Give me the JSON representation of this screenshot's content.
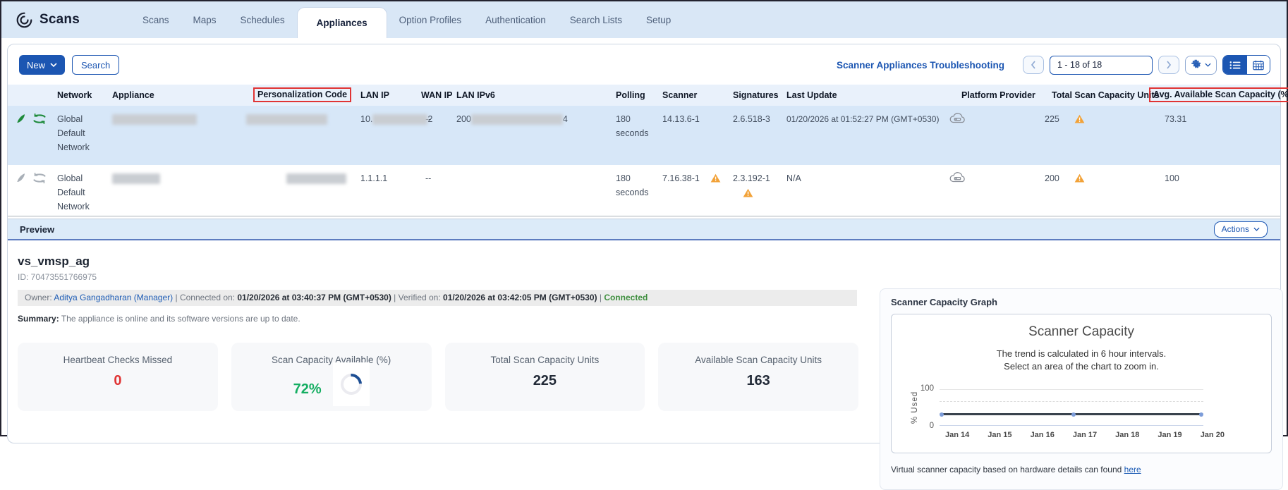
{
  "nav": {
    "app_title": "Scans",
    "tabs": [
      {
        "label": "Scans"
      },
      {
        "label": "Maps"
      },
      {
        "label": "Schedules"
      },
      {
        "label": "Appliances"
      },
      {
        "label": "Option Profiles"
      },
      {
        "label": "Authentication"
      },
      {
        "label": "Search Lists"
      },
      {
        "label": "Setup"
      }
    ]
  },
  "toolbar": {
    "new_label": "New",
    "search_label": "Search",
    "troubleshooting_link": "Scanner Appliances Troubleshooting",
    "pagination_text": "1 - 18 of 18"
  },
  "icons": {
    "sort_ascending": "↑"
  },
  "table": {
    "columns": [
      "Network",
      "Appliance",
      "Personalization Code",
      "LAN IP",
      "WAN IP",
      "LAN IPv6",
      "Polling",
      "Scanner",
      "Signatures",
      "Last Update",
      "Platform Provider",
      "Total Scan Capacity Units",
      "Avg. Available Scan Capacity (%)"
    ],
    "rows": [
      {
        "network": "Global Default Network",
        "lan_ip_prefix": "10.",
        "lan_ip_suffix": "2",
        "wan_ip": "--",
        "lan_ipv6_prefix": "200",
        "lan_ipv6_suffix": "4",
        "polling": "180 seconds",
        "scanner": "14.13.6-1",
        "signatures": "2.6.518-3",
        "last_update": "01/20/2026 at 01:52:27 PM (GMT+0530)",
        "total_units": "225",
        "avg_available": "73.31"
      },
      {
        "network": "Global Default Network",
        "lan_ip": "1.1.1.1",
        "wan_ip": "--",
        "polling": "180 seconds",
        "scanner": "7.16.38-1",
        "signatures": "2.3.192-1",
        "last_update": "N/A",
        "total_units": "200",
        "avg_available": "100"
      }
    ]
  },
  "preview": {
    "title": "Preview",
    "actions_label": "Actions",
    "appliance_name": "vs_vmsp_ag",
    "id_text": "ID: 70473551766975",
    "owner_label": "Owner:",
    "owner_name": "Aditya Gangadharan (Manager)",
    "separator": "|",
    "connected_on_label": "Connected on:",
    "connected_on": "01/20/2026 at 03:40:37 PM (GMT+0530)",
    "verified_on_label": "Verified on:",
    "verified_on": "01/20/2026 at 03:42:05 PM (GMT+0530)",
    "status": "Connected",
    "summary_label": "Summary:",
    "summary": "The appliance is online and its software versions are up to date.",
    "stats": [
      {
        "label": "Heartbeat Checks Missed",
        "value": "0"
      },
      {
        "label": "Scan Capacity Available (%)",
        "value": "72%"
      },
      {
        "label": "Total Scan Capacity Units",
        "value": "225"
      },
      {
        "label": "Available Scan Capacity Units",
        "value": "163"
      }
    ]
  },
  "graph": {
    "heading": "Scanner Capacity Graph",
    "footer_text": "Virtual scanner capacity based on hardware details can found",
    "footer_link_text": "here"
  },
  "chart_data": {
    "type": "line",
    "title": "Scanner Capacity",
    "subtitle_line1": "The trend is calculated in 6 hour intervals.",
    "subtitle_line2": "Select an area of the chart to zoom in.",
    "ylabel": "% Used",
    "x": [
      "Jan 14",
      "Jan 15",
      "Jan 16",
      "Jan 17",
      "Jan 18",
      "Jan 19",
      "Jan 20"
    ],
    "series": [
      {
        "name": "% Used",
        "values": [
          27,
          27,
          27,
          27,
          27,
          27,
          27
        ]
      }
    ],
    "ylim": [
      0,
      100
    ],
    "grid": "dashed-horizontal",
    "legend": "none"
  },
  "colors": {
    "accent_blue": "#1c56b2",
    "selected_row": "#d7e7f8",
    "warning_orange": "#f2a238",
    "annotation_red": "#e03434",
    "success_green": "#15ae62",
    "error_red": "#e03434",
    "connected_green": "#3f8f3f",
    "trend_line": "#39424d"
  }
}
